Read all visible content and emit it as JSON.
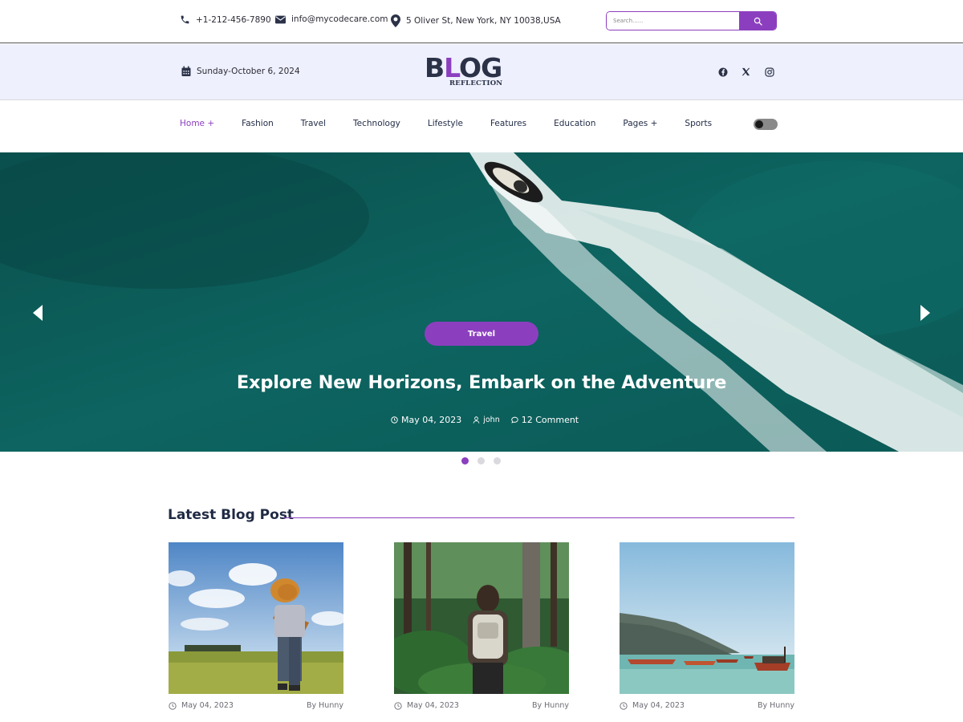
{
  "topbar": {
    "phone": "+1-212-456-7890",
    "email": "info@mycodecare.com",
    "address": "5 Oliver St, New York, NY 10038,USA",
    "search_placeholder": "Search......",
    "accent": "#8b3fbf"
  },
  "header": {
    "date": "Sunday-October 6, 2024",
    "logo": {
      "main": "BLOG",
      "sub": "REFLECTION"
    },
    "socials": [
      "facebook-icon",
      "x-icon",
      "instagram-icon"
    ]
  },
  "nav": {
    "items": [
      {
        "label": "Home +",
        "active": true
      },
      {
        "label": "Fashion"
      },
      {
        "label": "Travel"
      },
      {
        "label": "Technology"
      },
      {
        "label": "Lifestyle"
      },
      {
        "label": "Features"
      },
      {
        "label": "Education"
      },
      {
        "label": "Pages +"
      },
      {
        "label": "Sports"
      }
    ]
  },
  "hero": {
    "tag": "Travel",
    "title": "Explore New Horizons, Embark on the Adventure",
    "date": "May 04, 2023",
    "author": "john",
    "comments": "12 Comment",
    "slides": 3,
    "active_slide": 1
  },
  "latest": {
    "title": "Latest Blog Post",
    "cards": [
      {
        "date": "May 04, 2023",
        "author": "By Hunny"
      },
      {
        "date": "May 04, 2023",
        "author": "By Hunny"
      },
      {
        "date": "May 04, 2023",
        "author": "By Hunny"
      }
    ]
  }
}
